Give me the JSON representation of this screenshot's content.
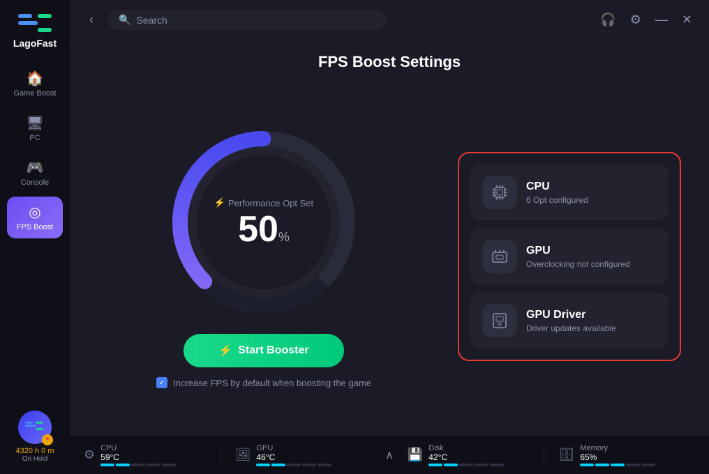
{
  "app": {
    "name": "LagoFast"
  },
  "header": {
    "search_placeholder": "Search",
    "back_label": "‹"
  },
  "page": {
    "title": "FPS Boost Settings"
  },
  "sidebar": {
    "items": [
      {
        "id": "game-boost",
        "label": "Game Boost",
        "icon": "🏠",
        "active": false
      },
      {
        "id": "pc",
        "label": "PC",
        "icon": "🖥",
        "active": false
      },
      {
        "id": "console",
        "label": "Console",
        "icon": "🎮",
        "active": false
      },
      {
        "id": "fps-boost",
        "label": "FPS Boost",
        "icon": "◎",
        "active": true
      }
    ]
  },
  "user": {
    "time_label": "4320 h 0 m",
    "status": "On Hold"
  },
  "gauge": {
    "label": "Performance Opt Set",
    "value": "50",
    "unit": "%"
  },
  "boost_button": {
    "label": "Start Booster",
    "icon": "⚡"
  },
  "checkbox": {
    "label": "Increase FPS by default when boosting the game",
    "checked": true
  },
  "cards": [
    {
      "id": "cpu",
      "name": "CPU",
      "sub": "6 Opt configured",
      "icon": "⚙"
    },
    {
      "id": "gpu",
      "name": "GPU",
      "sub": "Overclocking not configured",
      "icon": "🖼"
    },
    {
      "id": "gpu-driver",
      "name": "GPU Driver",
      "sub": "Driver updates available",
      "icon": "💾"
    }
  ],
  "status_bar": {
    "items": [
      {
        "id": "cpu",
        "label": "CPU",
        "value": "59°C",
        "filled": 2,
        "total": 5
      },
      {
        "id": "gpu",
        "label": "GPU",
        "value": "46°C",
        "filled": 2,
        "total": 5
      },
      {
        "id": "disk",
        "label": "Disk",
        "value": "42°C",
        "filled": 2,
        "total": 5
      },
      {
        "id": "memory",
        "label": "Memory",
        "value": "65%",
        "filled": 3,
        "total": 5
      }
    ]
  }
}
